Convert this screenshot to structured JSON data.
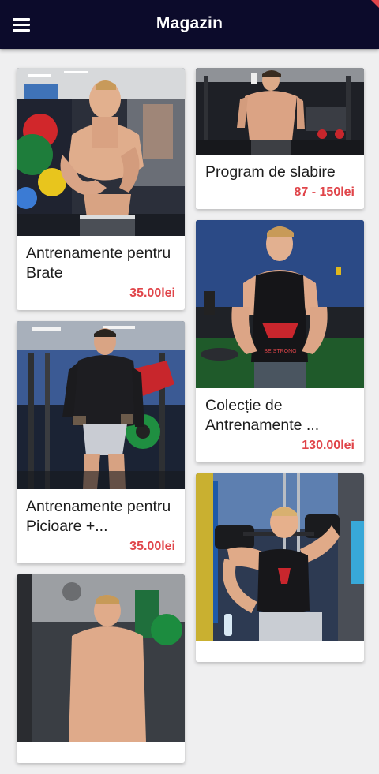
{
  "header": {
    "title": "Magazin",
    "background": "#0c0b2b",
    "menu_icon": "hamburger-menu-icon"
  },
  "accent_color": "#e0454a",
  "products": [
    {
      "title": "Antrenamente pentru Brate",
      "price": "35.00lei",
      "image": "shirtless-athlete-flexing-in-gym"
    },
    {
      "title": "Program de slabire",
      "price": "87 - 150lei",
      "image": "shirtless-athlete-front-pose-in-gym"
    },
    {
      "title": "Antrenamente pentru Picioare +...",
      "price": "35.00lei",
      "image": "athlete-in-hoodie-at-leg-press-machine"
    },
    {
      "title": "Colecție de Antrenamente ...",
      "price": "130.00lei",
      "image": "athlete-in-black-tank-top-superhero-logo"
    },
    {
      "title": "",
      "price": "",
      "image": "shirtless-athlete-side-pose-in-gym"
    },
    {
      "title": "",
      "price": "",
      "image": "athlete-pressing-dumbbells-overhead"
    }
  ]
}
